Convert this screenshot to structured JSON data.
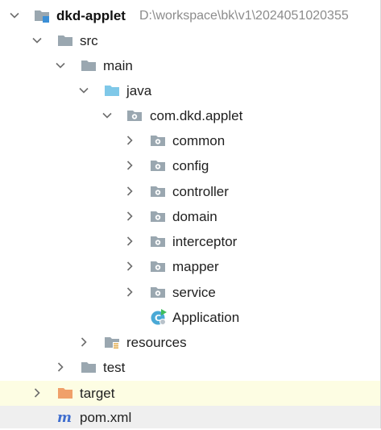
{
  "project": {
    "name": "dkd-applet",
    "path": "D:\\workspace\\bk\\v1\\2024051020355"
  },
  "tree": {
    "src": "src",
    "main": "main",
    "java": "java",
    "package": "com.dkd.applet",
    "packages": [
      "common",
      "config",
      "controller",
      "domain",
      "interceptor",
      "mapper",
      "service"
    ],
    "application": "Application",
    "resources": "resources",
    "test": "test",
    "target": "target",
    "pom": "pom.xml"
  },
  "colors": {
    "folder": "#9aa7b0",
    "java_folder": "#7fc8e8",
    "target_folder": "#f0a06a",
    "target_highlight": "#fdfde3",
    "pom_highlight": "#efefef",
    "maven": "#3f6ecf",
    "application_icon": "#4aa9d6",
    "run_badge": "#3fbe5b"
  },
  "icons": {
    "expanded": "chevron-down-icon",
    "collapsed": "chevron-right-icon",
    "module": "module-folder-icon",
    "folder": "folder-icon",
    "source_root": "source-root-folder-icon",
    "package": "package-icon",
    "resources": "resources-folder-icon",
    "excluded": "excluded-folder-icon",
    "maven": "maven-icon",
    "class": "spring-application-class-icon"
  }
}
